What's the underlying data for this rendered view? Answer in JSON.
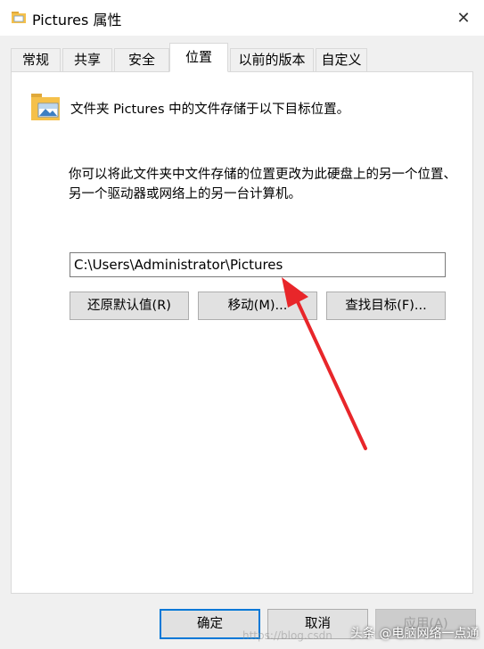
{
  "window": {
    "title": "Pictures 属性",
    "close_icon": "close-icon"
  },
  "tabs": [
    {
      "label": "常规"
    },
    {
      "label": "共享"
    },
    {
      "label": "安全"
    },
    {
      "label": "位置",
      "active": true
    },
    {
      "label": "以前的版本"
    },
    {
      "label": "自定义"
    }
  ],
  "location": {
    "heading": "文件夹 Pictures 中的文件存储于以下目标位置。",
    "description": "你可以将此文件夹中文件存储的位置更改为此硬盘上的另一个位置、另一个驱动器或网络上的另一台计算机。",
    "path_value": "C:\\Users\\Administrator\\Pictures",
    "buttons": {
      "restore": "还原默认值(R)",
      "move": "移动(M)...",
      "find_target": "查找目标(F)..."
    }
  },
  "footer": {
    "ok": "确定",
    "cancel": "取消",
    "apply": "应用(A)"
  },
  "watermark": {
    "url": "https://blog.csdn",
    "label": "头条 @电脑网络一点通"
  },
  "annotation": {
    "arrow_color": "#e8262a"
  },
  "colors": {
    "accent": "#0078d7",
    "folder": "#f5c04a"
  }
}
